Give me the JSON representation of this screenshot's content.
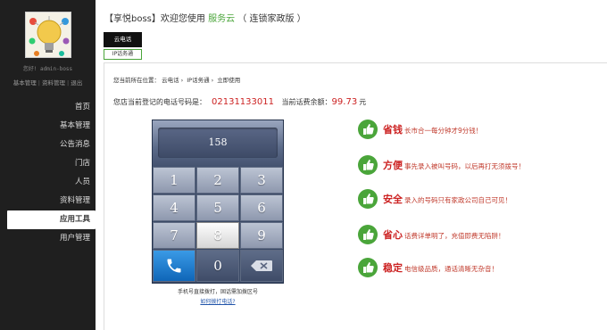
{
  "sidebar": {
    "greeting": "您好! admin-boss",
    "quick_links": [
      "基本管理",
      "资料管理",
      "退出"
    ],
    "menu": [
      "首页",
      "基本管理",
      "公告消息",
      "门店",
      "人员",
      "资料管理",
      "应用工具",
      "用户管理"
    ],
    "active_index": 6
  },
  "header": {
    "prefix": "【享悦boss】欢迎您使用",
    "service": "服务云",
    "suffix": "（ 连锁家政版 ）"
  },
  "tabs": {
    "primary": "云电话",
    "secondary": "IP话务通"
  },
  "breadcrumb": [
    "您当前所在位置：",
    "云电话",
    "IP话务通",
    "立即使用"
  ],
  "account": {
    "phone_label": "您店当前登记的电话号码是：",
    "phone_number": "02131133011",
    "balance_label": "当前话费余额：",
    "balance_value": "99.73",
    "balance_unit": "元"
  },
  "dialer": {
    "display": "158",
    "keys": [
      "1",
      "2",
      "3",
      "4",
      "5",
      "6",
      "7",
      "8",
      "9",
      "",
      "0",
      ""
    ],
    "active_key": "8",
    "note": "手机号直接拨打，固话需加拨区号",
    "link": "如何拨打电话?"
  },
  "features": [
    {
      "title": "省钱",
      "desc": "长市合一每分钟才9分钱！"
    },
    {
      "title": "方便",
      "desc": "事先录入被叫号码，以后再打无须拨号！"
    },
    {
      "title": "安全",
      "desc": "录入的号码只有家政公司自己可见！"
    },
    {
      "title": "省心",
      "desc": "话费详单明了，充值即费无陷阱！"
    },
    {
      "title": "稳定",
      "desc": "电信级品质，通话清晰无杂音！"
    }
  ],
  "colors": {
    "sidebar_bg": "#1f1f1f",
    "accent_green": "#4aa53a",
    "highlight_red": "#cc2222"
  }
}
